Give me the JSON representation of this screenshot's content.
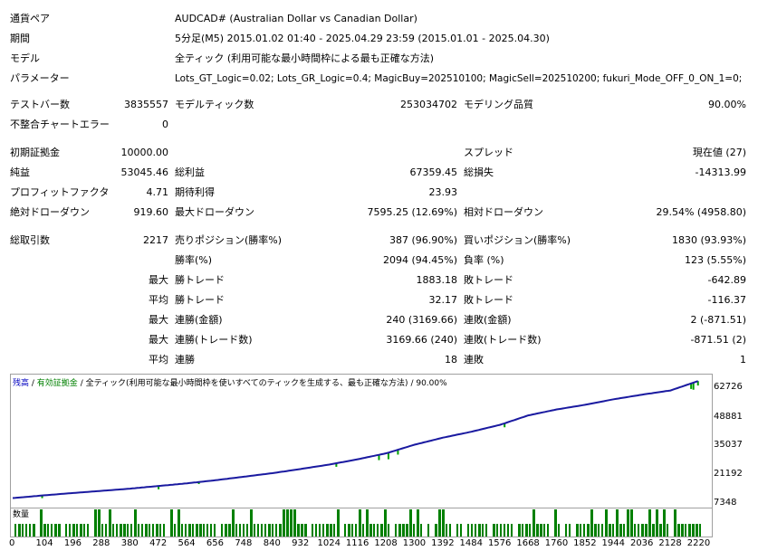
{
  "report": {
    "symbol_label": "通貨ペア",
    "symbol_value": "AUDCAD# (Australian Dollar vs Canadian Dollar)",
    "period_label": "期間",
    "period_value": "5分足(M5) 2015.01.02 01:40 - 2025.04.29 23:59 (2015.01.01 - 2025.04.30)",
    "model_label": "モデル",
    "model_value": "全ティック (利用可能な最小時間枠による最も正確な方法)",
    "params_label": "パラメーター",
    "params_value": "Lots_GT_Logic=0.02; Lots_GR_Logic=0.4; MagicBuy=202510100; MagicSell=202510200; fukuri_Mode_OFF_0_ON_1=0;",
    "bars_label": "テストバー数",
    "bars_value": "3835557",
    "ticks_label": "モデルティック数",
    "ticks_value": "253034702",
    "quality_label": "モデリング品質",
    "quality_value": "90.00%",
    "mismatch_label": "不整合チャートエラー",
    "mismatch_value": "0",
    "deposit_label": "初期証拠金",
    "deposit_value": "10000.00",
    "spread_label": "スプレッド",
    "spread_value": "現在値 (27)",
    "net_label": "純益",
    "net_value": "53045.46",
    "gross_profit_label": "総利益",
    "gross_profit_value": "67359.45",
    "gross_loss_label": "総損失",
    "gross_loss_value": "-14313.99",
    "pf_label": "プロフィットファクタ",
    "pf_value": "4.71",
    "expected_label": "期待利得",
    "expected_value": "23.93",
    "abs_dd_label": "絶対ドローダウン",
    "abs_dd_value": "919.60",
    "max_dd_label": "最大ドローダウン",
    "max_dd_value": "7595.25 (12.69%)",
    "rel_dd_label": "相対ドローダウン",
    "rel_dd_value": "29.54% (4958.80)",
    "trades_label": "総取引数",
    "trades_value": "2217",
    "short_label": "売りポジション(勝率%)",
    "short_value": "387 (96.90%)",
    "long_label": "買いポジション(勝率%)",
    "long_value": "1830 (93.93%)",
    "winrate_label": "勝率(%)",
    "winrate_value": "2094 (94.45%)",
    "lossrate_label": "負率 (%)",
    "lossrate_value": "123 (5.55%)",
    "max_label": "最大",
    "avg_label": "平均",
    "win_trade_label": "勝トレード",
    "largest_win_value": "1883.18",
    "loss_trade_label": "敗トレード",
    "largest_loss_value": "-642.89",
    "avg_win_value": "32.17",
    "avg_loss_value": "-116.37",
    "consec_wins_amt_label": "連勝(金額)",
    "consec_wins_amt_value": "240 (3169.66)",
    "consec_loss_amt_label": "連敗(金額)",
    "consec_loss_amt_value": "2 (-871.51)",
    "consec_wins_cnt_label": "連勝(トレード数)",
    "consec_wins_cnt_value": "3169.66 (240)",
    "consec_loss_cnt_label": "連敗(トレード数)",
    "consec_loss_cnt_value": "-871.51 (2)",
    "avg_consec_win_label": "連勝",
    "avg_consec_win_value": "18",
    "avg_consec_loss_label": "連敗",
    "avg_consec_loss_value": "1"
  },
  "chart": {
    "legend_balance": "残高",
    "legend_equity": "有効証拠金",
    "legend_model": "全ティック(利用可能な最小時間枠を使いすべてのティックを生成する、最も正確な方法)",
    "legend_quality": "90.00%",
    "volume_label": "数量",
    "y_ticks": [
      "62726",
      "48881",
      "35037",
      "21192",
      "7348"
    ],
    "x_ticks": [
      "0",
      "104",
      "196",
      "288",
      "380",
      "472",
      "564",
      "656",
      "748",
      "840",
      "932",
      "1024",
      "1116",
      "1208",
      "1300",
      "1392",
      "1484",
      "1576",
      "1668",
      "1760",
      "1852",
      "1944",
      "2036",
      "2128",
      "2220"
    ],
    "colors": {
      "balance": "#1a1aa0",
      "equity": "#00a000",
      "volume": "#008000",
      "legend_balance": "#0000c0",
      "legend_equity": "#008000"
    }
  },
  "chart_data": {
    "type": "line",
    "x": [
      0,
      104,
      196,
      288,
      380,
      472,
      564,
      656,
      748,
      840,
      932,
      1024,
      1116,
      1208,
      1300,
      1392,
      1484,
      1576,
      1668,
      1760,
      1852,
      1944,
      2036,
      2128,
      2217
    ],
    "series": [
      {
        "name": "残高",
        "values": [
          10000,
          11300,
          12300,
          13300,
          14300,
          15500,
          16700,
          18100,
          19700,
          21300,
          23200,
          25200,
          27600,
          30300,
          34200,
          37400,
          40100,
          43200,
          47500,
          50200,
          52300,
          54800,
          56900,
          58800,
          63050
        ]
      }
    ],
    "ylim": [
      7348,
      62726
    ],
    "xlim": [
      0,
      2250
    ]
  }
}
